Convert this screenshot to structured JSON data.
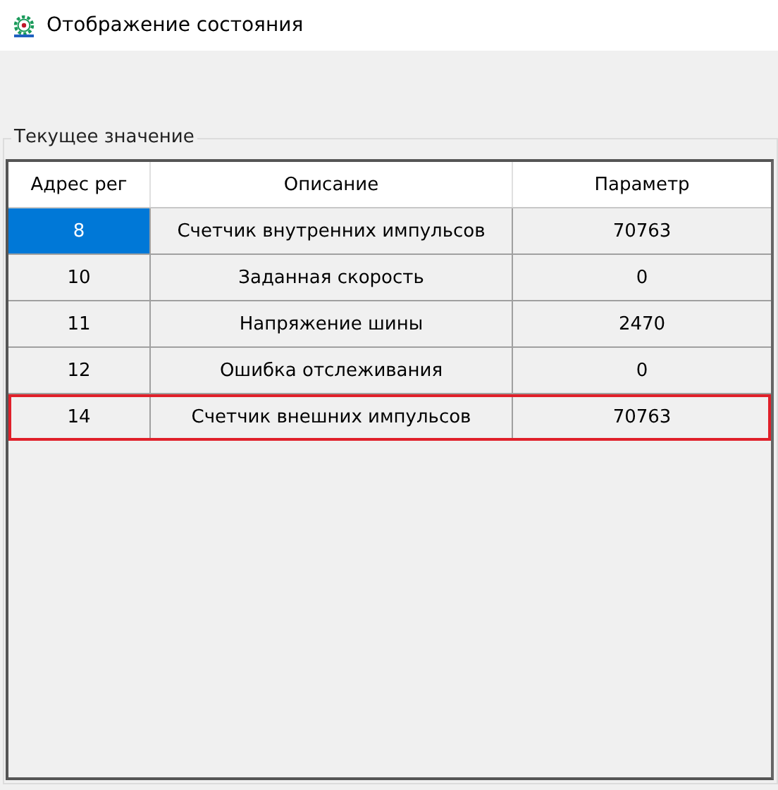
{
  "window": {
    "title": "Отображение состояния"
  },
  "group": {
    "title": "Текущее значение"
  },
  "table": {
    "columns": [
      "Адрес рег",
      "Описание",
      "Параметр"
    ],
    "rows": [
      {
        "cells": [
          "8",
          "Счетчик внутренних импульсов",
          "70763"
        ],
        "selected": true,
        "highlighted": false
      },
      {
        "cells": [
          "10",
          "Заданная скорость",
          "0"
        ],
        "selected": false,
        "highlighted": false
      },
      {
        "cells": [
          "11",
          "Напряжение шины",
          "2470"
        ],
        "selected": false,
        "highlighted": false
      },
      {
        "cells": [
          "12",
          "Ошибка отслеживания",
          "0"
        ],
        "selected": false,
        "highlighted": false
      },
      {
        "cells": [
          "14",
          "Счетчик внешних импульсов",
          "70763"
        ],
        "selected": false,
        "highlighted": true
      }
    ]
  }
}
